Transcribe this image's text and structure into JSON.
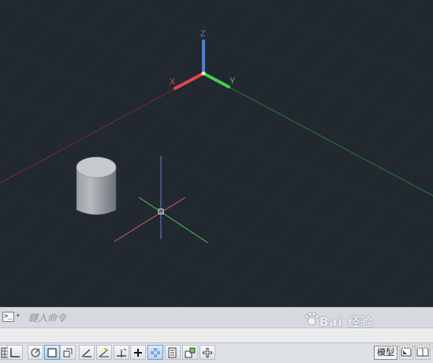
{
  "viewport": {
    "axis_labels": {
      "x": "X",
      "y": "Y",
      "z": "Z"
    },
    "colors": {
      "background": "#212830",
      "x_axis": "#e04848",
      "y_axis": "#3fd04a",
      "z_axis": "#4a7fd6"
    }
  },
  "command_line": {
    "placeholder": "鍵入命令",
    "icon": "command-prompt-icon",
    "arrow": "▾"
  },
  "status_bar": {
    "buttons": [
      {
        "name": "grid-icon",
        "on": false
      },
      {
        "name": "ortho-icon",
        "on": false
      },
      {
        "name": "polar-icon",
        "on": false
      },
      {
        "name": "osnap-icon",
        "on": true
      },
      {
        "name": "3d-osnap-icon",
        "on": false
      },
      {
        "name": "otrack-icon",
        "on": false
      },
      {
        "name": "ducs-icon",
        "on": false
      },
      {
        "name": "dyn-icon",
        "on": false
      },
      {
        "name": "lineweight-icon",
        "on": false
      },
      {
        "name": "transparency-icon",
        "on": true
      },
      {
        "name": "selection-cycling-icon",
        "on": false
      },
      {
        "name": "annotation-monitor-icon",
        "on": false
      },
      {
        "name": "quick-properties-icon",
        "on": false
      }
    ],
    "model_tab": "模型",
    "layout_icons": [
      "layout-icon",
      "viewport-icon"
    ]
  },
  "watermark": {
    "logo": "Bai 经验",
    "url": "jingyan.baidu.com"
  }
}
